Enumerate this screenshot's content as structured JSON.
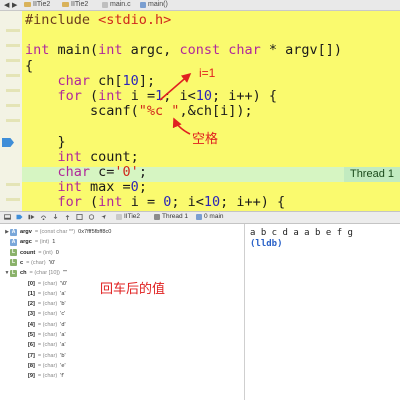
{
  "topbar": {
    "crumbs": [
      "IITie2",
      "IITie2",
      "main.c",
      "main()"
    ]
  },
  "editor": {
    "code_lines": [
      [
        {
          "t": "#include ",
          "c": "pre"
        },
        {
          "t": "<stdio.h>",
          "c": "str"
        }
      ],
      [],
      [
        {
          "t": "int ",
          "c": "kw"
        },
        {
          "t": "main(",
          "c": ""
        },
        {
          "t": "int ",
          "c": "kw"
        },
        {
          "t": "argc, ",
          "c": ""
        },
        {
          "t": "const ",
          "c": "kw"
        },
        {
          "t": "char ",
          "c": "kw"
        },
        {
          "t": "* argv[])",
          "c": ""
        }
      ],
      [
        {
          "t": "{",
          "c": ""
        }
      ],
      [
        {
          "t": "    ",
          "c": ""
        },
        {
          "t": "char ",
          "c": "kw"
        },
        {
          "t": "ch[",
          "c": ""
        },
        {
          "t": "10",
          "c": "num"
        },
        {
          "t": "];",
          "c": ""
        }
      ],
      [
        {
          "t": "    ",
          "c": ""
        },
        {
          "t": "for ",
          "c": "kw"
        },
        {
          "t": "(",
          "c": ""
        },
        {
          "t": "int ",
          "c": "kw"
        },
        {
          "t": "i =",
          "c": ""
        },
        {
          "t": "1",
          "c": "num"
        },
        {
          "t": "; i<",
          "c": ""
        },
        {
          "t": "10",
          "c": "num"
        },
        {
          "t": "; i++) {",
          "c": ""
        }
      ],
      [
        {
          "t": "        scanf(",
          "c": ""
        },
        {
          "t": "\"%c \"",
          "c": "str"
        },
        {
          "t": ",&ch[i]);",
          "c": ""
        }
      ],
      [],
      [
        {
          "t": "    }",
          "c": ""
        }
      ],
      [
        {
          "t": "    ",
          "c": ""
        },
        {
          "t": "int ",
          "c": "kw"
        },
        {
          "t": "count;",
          "c": ""
        }
      ],
      [
        {
          "t": "    ",
          "c": ""
        },
        {
          "t": "char ",
          "c": "kw"
        },
        {
          "t": "c=",
          "c": ""
        },
        {
          "t": "'0'",
          "c": "str"
        },
        {
          "t": ";",
          "c": ""
        }
      ],
      [
        {
          "t": "    ",
          "c": ""
        },
        {
          "t": "int ",
          "c": "kw"
        },
        {
          "t": "max =",
          "c": ""
        },
        {
          "t": "0",
          "c": "num"
        },
        {
          "t": ";",
          "c": ""
        }
      ],
      [
        {
          "t": "    ",
          "c": ""
        },
        {
          "t": "for ",
          "c": "kw"
        },
        {
          "t": "(",
          "c": ""
        },
        {
          "t": "int ",
          "c": "kw"
        },
        {
          "t": "i = ",
          "c": ""
        },
        {
          "t": "0",
          "c": "num"
        },
        {
          "t": "; i<",
          "c": ""
        },
        {
          "t": "10",
          "c": "num"
        },
        {
          "t": "; i++) {",
          "c": ""
        }
      ]
    ],
    "thread_badge": "Thread 1"
  },
  "annotations": {
    "i_equals_1": "i=1",
    "space": "空格",
    "value_after_enter": "回车后的值"
  },
  "debugbar": {
    "crumbs": [
      "IITie2",
      "Thread 1",
      "0 main"
    ]
  },
  "variables": [
    {
      "indent": 0,
      "tri": "▶",
      "icon": "A",
      "icon_kind": "a",
      "name": "argv",
      "type": "= (const char **)",
      "value": "0x7fff5fbff8c0"
    },
    {
      "indent": 0,
      "tri": "",
      "icon": "A",
      "icon_kind": "a",
      "name": "argc",
      "type": "= (int)",
      "value": "1"
    },
    {
      "indent": 0,
      "tri": "",
      "icon": "L",
      "icon_kind": "l",
      "name": "count",
      "type": "= (int)",
      "value": "0"
    },
    {
      "indent": 0,
      "tri": "",
      "icon": "L",
      "icon_kind": "l",
      "name": "c",
      "type": "= (char)",
      "value": "'\\0'"
    },
    {
      "indent": 0,
      "tri": "▼",
      "icon": "L",
      "icon_kind": "l",
      "name": "ch",
      "type": "= (char [10])",
      "value": "\"\""
    },
    {
      "indent": 1,
      "tri": "",
      "icon": "",
      "icon_kind": "",
      "name": "[0]",
      "type": "= (char)",
      "value": "'\\0'"
    },
    {
      "indent": 1,
      "tri": "",
      "icon": "",
      "icon_kind": "",
      "name": "[1]",
      "type": "= (char)",
      "value": "'a'"
    },
    {
      "indent": 1,
      "tri": "",
      "icon": "",
      "icon_kind": "",
      "name": "[2]",
      "type": "= (char)",
      "value": "'b'"
    },
    {
      "indent": 1,
      "tri": "",
      "icon": "",
      "icon_kind": "",
      "name": "[3]",
      "type": "= (char)",
      "value": "'c'"
    },
    {
      "indent": 1,
      "tri": "",
      "icon": "",
      "icon_kind": "",
      "name": "[4]",
      "type": "= (char)",
      "value": "'d'"
    },
    {
      "indent": 1,
      "tri": "",
      "icon": "",
      "icon_kind": "",
      "name": "[5]",
      "type": "= (char)",
      "value": "'a'"
    },
    {
      "indent": 1,
      "tri": "",
      "icon": "",
      "icon_kind": "",
      "name": "[6]",
      "type": "= (char)",
      "value": "'a'"
    },
    {
      "indent": 1,
      "tri": "",
      "icon": "",
      "icon_kind": "",
      "name": "[7]",
      "type": "= (char)",
      "value": "'b'"
    },
    {
      "indent": 1,
      "tri": "",
      "icon": "",
      "icon_kind": "",
      "name": "[8]",
      "type": "= (char)",
      "value": "'e'"
    },
    {
      "indent": 1,
      "tri": "",
      "icon": "",
      "icon_kind": "",
      "name": "[9]",
      "type": "= (char)",
      "value": "'f'"
    }
  ],
  "console": {
    "output": "a b c d a a b e f g",
    "prompt": "(lldb)"
  },
  "colors": {
    "editor_bg": "#fafa6e",
    "current_line": "#d6f5c2",
    "annotation": "#e02020",
    "keyword": "#b0299b",
    "string": "#d0281c",
    "number": "#2c26b8"
  }
}
